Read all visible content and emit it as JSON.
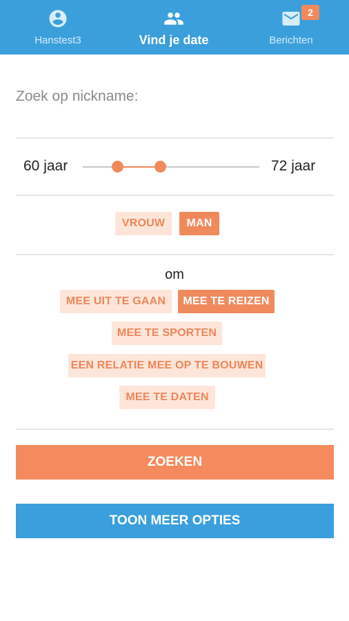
{
  "nav": {
    "tabs": [
      {
        "label": "Hanstest3",
        "icon": "account-circle-icon",
        "active": false
      },
      {
        "label": "Vind je date",
        "icon": "people-icon",
        "active": true
      },
      {
        "label": "Berichten",
        "icon": "mail-icon",
        "active": false,
        "badge": "2"
      }
    ]
  },
  "search": {
    "nickname_label": "Zoek op nickname:"
  },
  "age": {
    "min_label": "60 jaar",
    "max_label": "72 jaar",
    "min_value": 60,
    "max_value": 72
  },
  "gender": {
    "options": [
      {
        "label": "VROUW",
        "selected": false
      },
      {
        "label": "MAN",
        "selected": true
      }
    ]
  },
  "purpose": {
    "intro": "om",
    "options": [
      {
        "label": "MEE UIT TE GAAN",
        "selected": false
      },
      {
        "label": "MEE TE REIZEN",
        "selected": true
      },
      {
        "label": "MEE TE SPORTEN",
        "selected": false
      },
      {
        "label": "EEN RELATIE MEE OP TE BOUWEN",
        "selected": false
      },
      {
        "label": "MEE TE DATEN",
        "selected": false
      }
    ]
  },
  "actions": {
    "search_label": "ZOEKEN",
    "more_options_label": "TOON MEER OPTIES"
  },
  "colors": {
    "header": "#3b9fdb",
    "accent": "#f08a5d",
    "chip_off_bg": "#fde6d9",
    "secondary_button": "#3a9fdc"
  }
}
